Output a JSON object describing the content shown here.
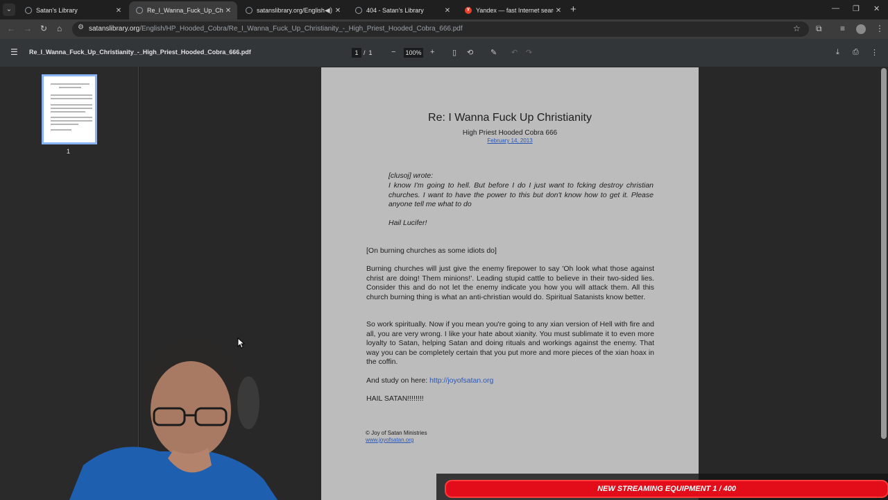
{
  "browser": {
    "tabs": [
      {
        "title": "Satan's Library",
        "favicon": "globe-icon"
      },
      {
        "title": "Re_I_Wanna_Fuck_Up_Christiani",
        "favicon": "globe-icon"
      },
      {
        "title": "satanslibrary.org/English/H",
        "favicon": "globe-icon"
      },
      {
        "title": "404 - Satan's Library",
        "favicon": "globe-icon"
      },
      {
        "title": "Yandex — fast Internet search",
        "favicon": "yandex-icon"
      }
    ],
    "address": {
      "host": "satanslibrary.org",
      "path": "/English/HP_Hooded_Cobra/Re_I_Wanna_Fuck_Up_Christianity_-_High_Priest_Hooded_Cobra_666.pdf"
    }
  },
  "pdf": {
    "filename": "Re_I_Wanna_Fuck_Up_Christianity_-_High_Priest_Hooded_Cobra_666.pdf",
    "current_page": "1",
    "separator": "/",
    "total_pages": "1",
    "zoom": "100%",
    "thumb_label": "1"
  },
  "document": {
    "title": "Re: I Wanna Fuck Up Christianity",
    "author": "High Priest Hooded Cobra 666",
    "date": "February 14, 2013",
    "quote_header": "[clusoj] wrote:",
    "quote_body": "I know I'm going to hell. But before I do I just want to fcking destroy christian churches. I want to have the power to this but don't know how to get it. Please anyone tell me what to do",
    "quote_sign": "Hail Lucifer!",
    "note": "[On burning churches as some idiots do]",
    "para1": "Burning churches will just give the enemy firepower to say 'Oh look what those against christ are doing! Them minions!'. Leading stupid cattle to believe in their two-sided lies. Consider this and do not let the enemy indicate you how you will attack them. All this church burning thing is what an anti-christian would do. Spiritual Satanists know better.",
    "para2": "So work spiritually. Now if you mean you're going to any xian version of Hell with fire and all, you are very wrong. I like your hate about xianity. You must sublimate it to even more loyalty to Satan, helping Satan and doing rituals and workings against the enemy. That way you can be completely certain that you put more and more pieces of the xian hoax in the coffin.",
    "study_prefix": "And study on here: ",
    "study_link": "http://joyofsatan.org",
    "closing": "HAIL SATAN!!!!!!!!",
    "footer_copy": "© Joy of Satan Ministries",
    "footer_link": "www.joyofsatan.org"
  },
  "overlay": {
    "banner_text": "NEW STREAMING EQUIPMENT 1 / 400"
  },
  "colors": {
    "accent": "#8ab4f8",
    "banner": "#e30d1a",
    "link": "#2a57b7"
  }
}
